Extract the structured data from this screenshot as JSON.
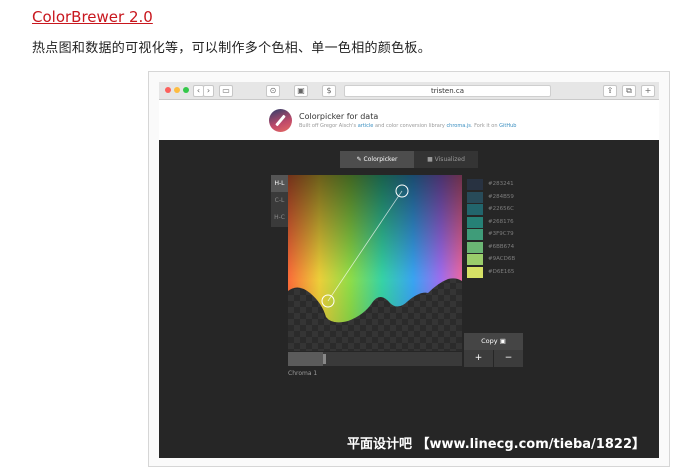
{
  "page": {
    "title": "ColorBrewer 2.0",
    "description": "热点图和数据的可视化等，可以制作多个色相、单一色相的颜色板。"
  },
  "browser": {
    "url": "tristen.ca",
    "nav_back": "‹",
    "nav_forward": "›"
  },
  "app": {
    "title": "Colorpicker for data",
    "subtitle_parts": {
      "a": "Built off Gregor Aisch's ",
      "article": "article",
      "b": " and color conversion library ",
      "lib": "chroma.js",
      "c": ". Fork it on ",
      "github": "GitHub"
    },
    "tabs": {
      "colorpicker": "Colorpicker",
      "visualized": "Visualized"
    },
    "modes": [
      "H-L",
      "C-L",
      "H-C"
    ],
    "slider_label": "Chroma 1",
    "chroma_fraction": 0.2,
    "copy_label": "Copy",
    "plus_label": "+",
    "minus_label": "−",
    "palette": [
      {
        "hex": "#283241",
        "color": "#283241"
      },
      {
        "hex": "#284B59",
        "color": "#284B59"
      },
      {
        "hex": "#22656C",
        "color": "#22656C"
      },
      {
        "hex": "#268176",
        "color": "#268176"
      },
      {
        "hex": "#3F9C79",
        "color": "#3F9C79"
      },
      {
        "hex": "#6BB674",
        "color": "#6BB674"
      },
      {
        "hex": "#9ACD6B",
        "color": "#9ACD6B"
      },
      {
        "hex": "#D6E165",
        "color": "#D6E165"
      }
    ]
  },
  "watermark": "平面设计吧 【www.linecg.com/tieba/1822】"
}
